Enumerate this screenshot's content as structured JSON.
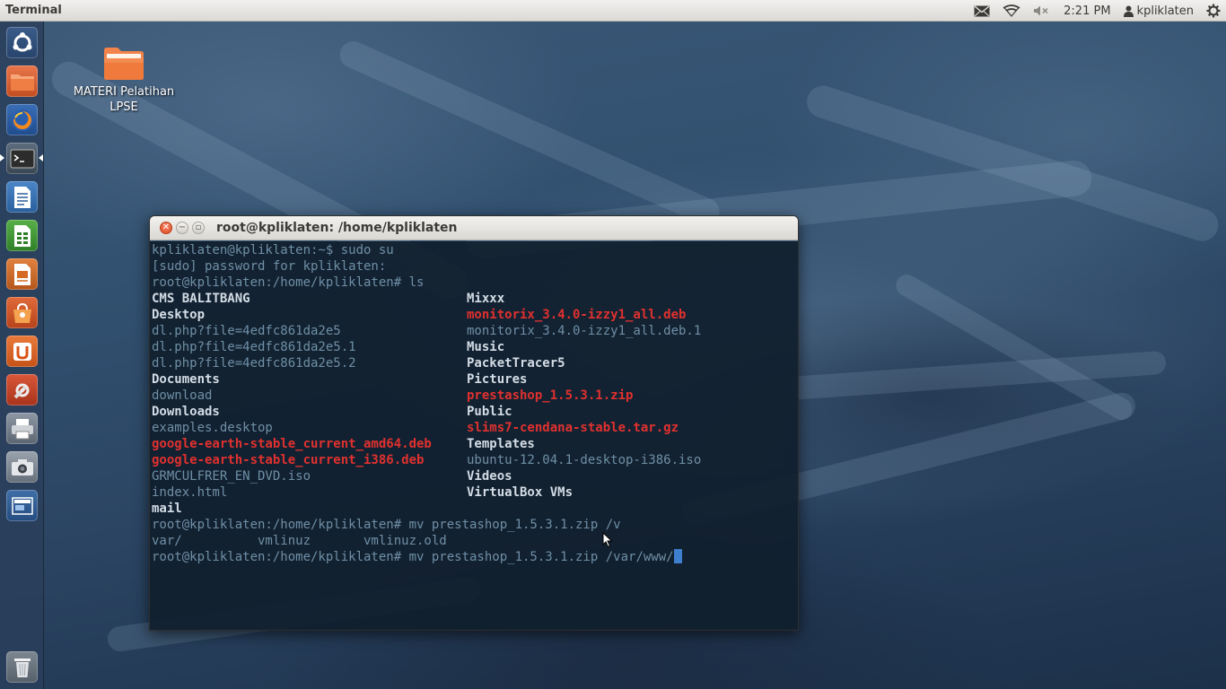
{
  "top_panel": {
    "app_title": "Terminal",
    "time": "2:21 PM",
    "username": "kpliklaten"
  },
  "launcher": {
    "items": [
      {
        "name": "dash-home",
        "active": false
      },
      {
        "name": "files",
        "active": false
      },
      {
        "name": "firefox",
        "active": false
      },
      {
        "name": "terminal",
        "active": true
      },
      {
        "name": "libreoffice-writer",
        "active": false
      },
      {
        "name": "libreoffice-calc",
        "active": false
      },
      {
        "name": "libreoffice-impress",
        "active": false
      },
      {
        "name": "software-center",
        "active": false
      },
      {
        "name": "ubuntu-one",
        "active": false
      },
      {
        "name": "system-settings",
        "active": false
      },
      {
        "name": "printer",
        "active": false
      },
      {
        "name": "camera",
        "active": false
      },
      {
        "name": "workspace-switcher",
        "active": false
      },
      {
        "name": "trash",
        "active": false
      }
    ]
  },
  "desktop": {
    "icon_label_line1": "MATERI Pelatihan",
    "icon_label_line2": "LPSE"
  },
  "terminal": {
    "title": "root@kpliklaten: /home/kpliklaten",
    "prompt_user": "kpliklaten@kpliklaten:~$ sudo su",
    "sudo_prompt": "[sudo] password for kpliklaten:",
    "ls_cmd": "root@kpliklaten:/home/kpliklaten# ls",
    "listing_col1": [
      {
        "text": "CMS BALITBANG",
        "kind": "dir"
      },
      {
        "text": "Desktop",
        "kind": "dir"
      },
      {
        "text": "dl.php?file=4edfc861da2e5",
        "kind": "file"
      },
      {
        "text": "dl.php?file=4edfc861da2e5.1",
        "kind": "file"
      },
      {
        "text": "dl.php?file=4edfc861da2e5.2",
        "kind": "file"
      },
      {
        "text": "Documents",
        "kind": "dir"
      },
      {
        "text": "download",
        "kind": "file"
      },
      {
        "text": "Downloads",
        "kind": "dir"
      },
      {
        "text": "examples.desktop",
        "kind": "file"
      },
      {
        "text": "google-earth-stable_current_amd64.deb",
        "kind": "arch"
      },
      {
        "text": "google-earth-stable_current_i386.deb",
        "kind": "arch"
      },
      {
        "text": "GRMCULFRER_EN_DVD.iso",
        "kind": "file"
      },
      {
        "text": "index.html",
        "kind": "file"
      },
      {
        "text": "mail",
        "kind": "dir"
      }
    ],
    "listing_col2": [
      {
        "text": "Mixxx",
        "kind": "dir"
      },
      {
        "text": "monitorix_3.4.0-izzy1_all.deb",
        "kind": "arch"
      },
      {
        "text": "monitorix_3.4.0-izzy1_all.deb.1",
        "kind": "file"
      },
      {
        "text": "Music",
        "kind": "dir"
      },
      {
        "text": "PacketTracer5",
        "kind": "dir"
      },
      {
        "text": "Pictures",
        "kind": "dir"
      },
      {
        "text": "prestashop_1.5.3.1.zip",
        "kind": "arch"
      },
      {
        "text": "Public",
        "kind": "dir"
      },
      {
        "text": "slims7-cendana-stable.tar.gz",
        "kind": "arch"
      },
      {
        "text": "Templates",
        "kind": "dir"
      },
      {
        "text": "ubuntu-12.04.1-desktop-i386.iso",
        "kind": "file"
      },
      {
        "text": "Videos",
        "kind": "dir"
      },
      {
        "text": "VirtualBox VMs",
        "kind": "dir"
      },
      {
        "text": "",
        "kind": "file"
      }
    ],
    "mv_cmd_1": "root@kpliklaten:/home/kpliklaten# mv prestashop_1.5.3.1.zip /v",
    "completions": "var/          vmlinuz       vmlinuz.old",
    "mv_cmd_2": "root@kpliklaten:/home/kpliklaten# mv prestashop_1.5.3.1.zip /var/www/"
  },
  "colors": {
    "terminal_text": "#6f8fa6",
    "directory": "#d4dde6",
    "archive": "#e0312f",
    "cursor": "#3e7fce",
    "panel_bg": "#dcdad5"
  }
}
